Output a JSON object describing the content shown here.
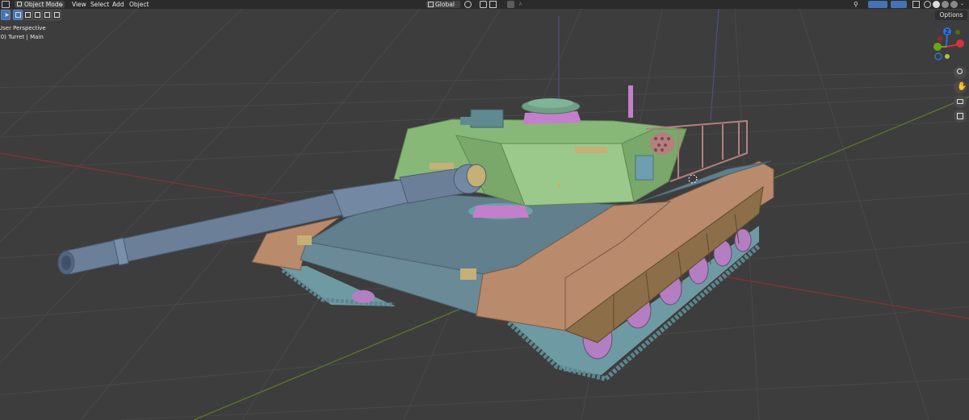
{
  "header": {
    "mode_label": "Object Mode",
    "menu": [
      "View",
      "Select",
      "Add",
      "Object"
    ],
    "transform_orientation": "Global"
  },
  "viewport": {
    "view_name": "User Perspective",
    "object_info": "(0) Turret | Main",
    "options_label": "Options"
  },
  "gizmo": {
    "axes": [
      {
        "label": "Z",
        "color": "#2f6fd6"
      },
      {
        "label": "Y",
        "color": "#6ca51a"
      },
      {
        "label": "X",
        "color": "#d9303e"
      }
    ]
  },
  "icons": {
    "select": "cursor-icon",
    "zoom": "zoom-icon",
    "pan": "hand-icon",
    "camera": "camera-icon",
    "grid": "grid-icon"
  },
  "colors": {
    "header_bg": "#2b2b2b",
    "viewport_bg": "#3d3d3d",
    "active_blue": "#4772b3"
  }
}
